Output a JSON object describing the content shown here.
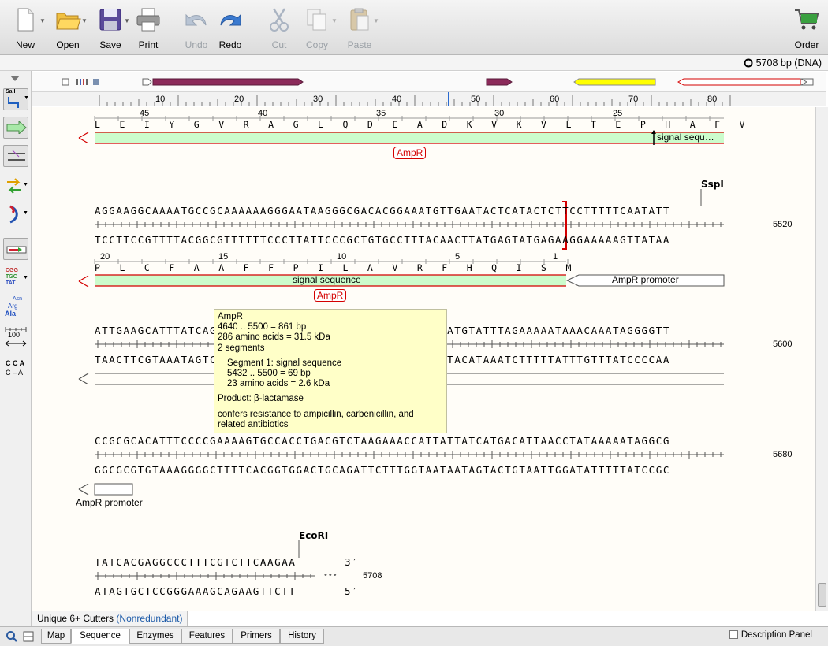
{
  "toolbar": {
    "new": "New",
    "open": "Open",
    "save": "Save",
    "print": "Print",
    "undo": "Undo",
    "redo": "Redo",
    "cut": "Cut",
    "copy": "Copy",
    "paste": "Paste",
    "order": "Order"
  },
  "info": {
    "length": "5708 bp  (DNA)"
  },
  "left_tools": {
    "site_label": "SalI",
    "scale_label": "100",
    "codon_top": "CGG",
    "codon_mid": "TGC",
    "codon_bot": "TAT",
    "aa_top": "Asn",
    "aa_mid": "Arg",
    "aa_bot": "Ala",
    "cca_top": "C C A",
    "cca_bot": "C – A"
  },
  "ruler": {
    "ticks": [
      "10",
      "20",
      "30",
      "40",
      "50",
      "60",
      "70",
      "80"
    ]
  },
  "rows": {
    "r1": {
      "aa_numbers": [
        "45",
        "40",
        "35",
        "30",
        "25"
      ],
      "aa": "L E I Y G V R A G L Q D E A D K V K V L T E P H A F V",
      "feature_label": "signal sequ…",
      "tag": "AmpR"
    },
    "r2": {
      "enzyme": "SspI",
      "top": "AGGAAGGCAAAATGCCGCAAAAAAGGGAATAAGGGCGACACGGAAATGTTGAATACTCATACTCTTCCTTTTTCAATATT",
      "bottom": "TCCTTCCGTTTTACGGCGTTTTTTCCCTTATTCCCGCTGTGCCTTTACAACTTATGAGTATGAGAAGGAAAAAGTTATAA",
      "position": "5520",
      "aa_numbers": [
        "20",
        "15",
        "10",
        "5",
        "1"
      ],
      "aa": "P L C F A A F F P I L A V R F H Q I S M",
      "feature_label": "signal sequence",
      "promoter_label": "AmpR promoter",
      "tag": "AmpR"
    },
    "r3": {
      "top": "ATTGAAGCATTTATCAGGGTTATTGTCTCATGAGCGGATACATATTTGAATGTATTTAGAAAAATAAACAAATAGGGGTT",
      "bottom": "TAACTTCGTAAATAGTCCCAATAACAGAGTACTCGCCTATGTATAAACTTACATAAATCTTTTTATTTGTTTATCCCCAA",
      "position": "5600"
    },
    "r4": {
      "top": "CCGCGCACATTTCCCCGAAAAGTGCCACCTGACGTCTAAGAAACCATTATTATCATGACATTAACCTATAAAAATAGGCG",
      "bottom": "GGCGCGTGTAAAGGGGCTTTTCACGGTGGACTGCAGATTCTTTGGTAATAATAGTACTGTAATTGGATATTTTTATCCGC",
      "position": "5680",
      "promoter_label": "AmpR promoter"
    },
    "r5": {
      "enzyme": "EcoRI",
      "top": "TATCACGAGGCCCTTTCGTCTTCAAGAA",
      "top_end": "3′",
      "bottom": "ATAGTGCTCCGGGAAAGCAGAAGTTCTT",
      "bottom_end": "5′",
      "ellipsis": "•••",
      "position": "5708"
    }
  },
  "tooltip": {
    "name": "AmpR",
    "range": "4640 .. 5500  =  861 bp",
    "aa": "286 amino acids  =  31.5 kDa",
    "segments": "2 segments",
    "seg1": "Segment 1:  signal sequence",
    "seg1_range": "5432 .. 5500  =  69 bp",
    "seg1_aa": "23 amino acids  =  2.6 kDa",
    "product": "Product: β-lactamase",
    "note": "confers resistance to ampicillin, carbenicillin, and related antibiotics"
  },
  "enzyme_set": {
    "label": "Unique 6+ Cutters",
    "mode": "(Nonredundant)"
  },
  "tabs": [
    "Map",
    "Sequence",
    "Enzymes",
    "Features",
    "Primers",
    "History"
  ],
  "active_tab": "Sequence",
  "description_panel": "Description Panel",
  "colors": {
    "feature_fill": "#ccfccc",
    "feature_line": "#d40000",
    "promoter_fill": "#ffffff",
    "map_purple": "#8b2a5a",
    "map_yellow": "#ffff00",
    "accent_blue": "#2060c0"
  }
}
